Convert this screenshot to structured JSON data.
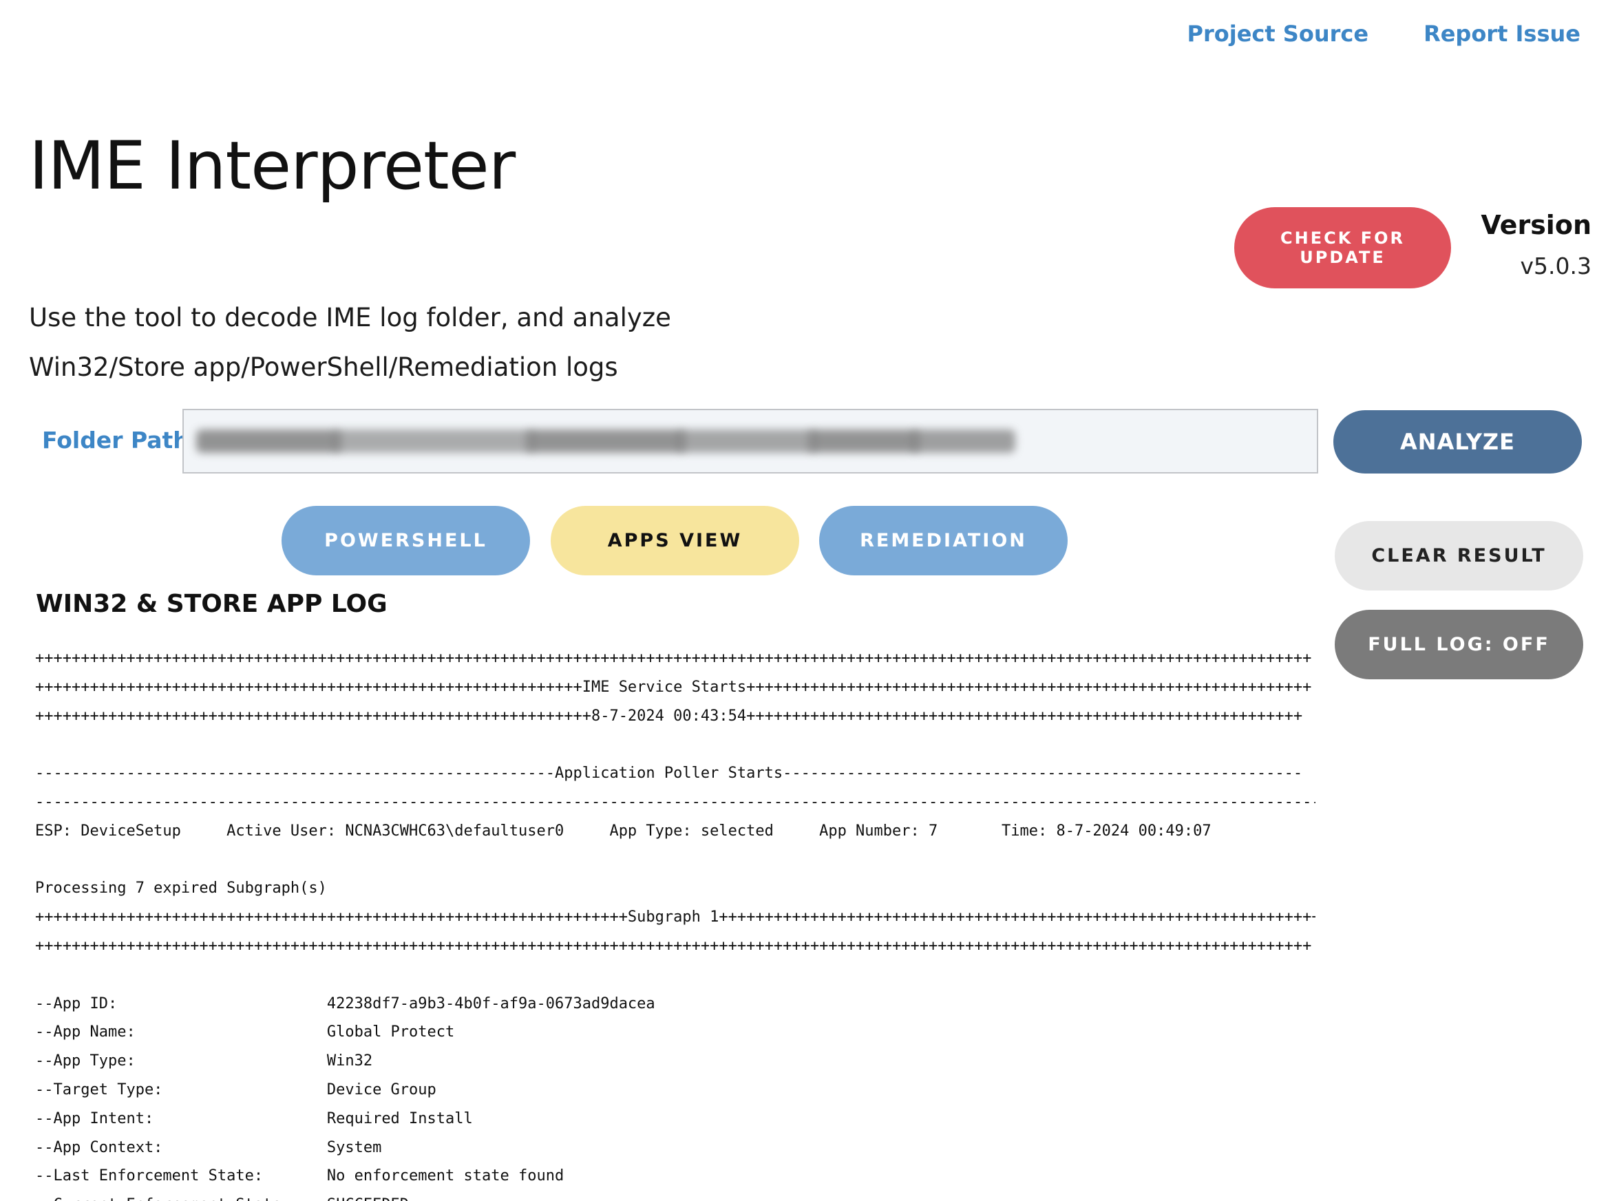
{
  "header": {
    "links": [
      "Project Source",
      "Report Issue"
    ]
  },
  "page": {
    "title": "IME Interpreter",
    "description_line1": "Use the tool to decode IME log folder, and analyze",
    "description_line2": "Win32/Store app/PowerShell/Remediation logs"
  },
  "version": {
    "label": "Version",
    "value": "v5.0.3",
    "check_update_label": "CHECK FOR UPDATE"
  },
  "folder": {
    "label": "Folder Path",
    "value": ""
  },
  "buttons": {
    "analyze": "ANALYZE",
    "powershell": "POWERSHELL",
    "apps_view": "APPS VIEW",
    "remediation": "REMEDIATION",
    "clear_result": "CLEAR RESULT",
    "full_log": "FULL LOG: OFF"
  },
  "colors": {
    "link": "#3d86c6",
    "check_update": "#e0525c",
    "analyze": "#4d7198",
    "view_blue": "#7aaad8",
    "apps_view": "#f7e59d",
    "clear_result": "#e7e7e7",
    "full_log": "#7b7b7b",
    "input_bg": "#f2f5f8"
  },
  "log": {
    "heading": "WIN32 & STORE APP LOG",
    "lines": [
      "++++++++++++++++++++++++++++++++++++++++++++++++++++++++++++++++++++++++++++++++++++++++++++++++++++++++++++++++++++++++++++++++++++++++++++",
      "++++++++++++++++++++++++++++++++++++++++++++++++++++++++++++IME Service Starts++++++++++++++++++++++++++++++++++++++++++++++++++++++++++++++",
      "+++++++++++++++++++++++++++++++++++++++++++++++++++++++++++++8-7-2024 00:43:54+++++++++++++++++++++++++++++++++++++++++++++++++++++++++++++",
      "",
      "---------------------------------------------------------Application Poller Starts---------------------------------------------------------",
      "---------------------------------------------------------------------------------------------------------------------------------------------",
      "ESP: DeviceSetup     Active User: NCNA3CWHC63\\defaultuser0     App Type: selected     App Number: 7       Time: 8-7-2024 00:49:07",
      "",
      "Processing 7 expired Subgraph(s)",
      "+++++++++++++++++++++++++++++++++++++++++++++++++++++++++++++++++Subgraph 1+++++++++++++++++++++++++++++++++++++++++++++++++++++++++++++++++++",
      "++++++++++++++++++++++++++++++++++++++++++++++++++++++++++++++++++++++++++++++++++++++++++++++++++++++++++++++++++++++++++++++++++++++++++++",
      "",
      "--App ID:                       42238df7-a9b3-4b0f-af9a-0673ad9dacea",
      "--App Name:                     Global Protect",
      "--App Type:                     Win32",
      "--Target Type:                  Device Group",
      "--App Intent:                   Required Install",
      "--App Context:                  System",
      "--Last Enforcement State:       No enforcement state found",
      "--Current Enforcement State:    SUCCEEDED"
    ]
  }
}
